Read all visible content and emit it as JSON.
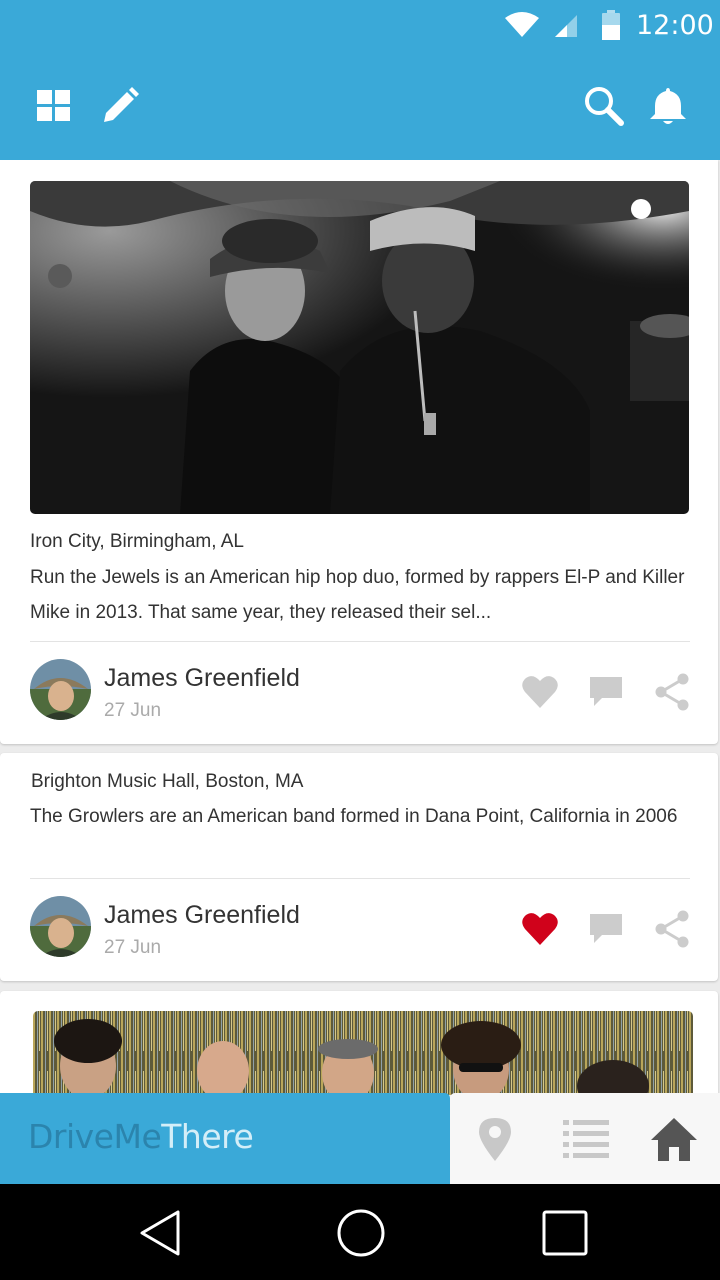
{
  "status": {
    "time": "12:00"
  },
  "app_bar": {
    "left_icons": [
      "grid-icon",
      "edit-icon"
    ],
    "right_icons": [
      "search-icon",
      "bell-icon"
    ]
  },
  "posts": [
    {
      "location": "Iron City, Birmingham, AL",
      "description": "Run the Jewels is an American hip hop duo, formed by rappers El-P and Killer Mike in 2013. That same year, they released their sel...",
      "author": "James Greenfield",
      "date": "27 Jun",
      "liked": false
    },
    {
      "location": "Brighton Music Hall, Boston, MA",
      "description": "The Growlers are an American band formed in Dana Point, California in 2006",
      "author": "James Greenfield",
      "date": "27 Jun",
      "liked": true
    }
  ],
  "brand": {
    "part1": "DriveMe",
    "part2": "There"
  },
  "bottom_tabs": [
    "location-pin-icon",
    "list-icon",
    "home-icon"
  ],
  "system_nav": [
    "back-icon",
    "home-circle-icon",
    "recents-icon"
  ],
  "colors": {
    "primary": "#3aa9d8",
    "like_active": "#d0021b",
    "icon_inactive": "#cccccc"
  }
}
